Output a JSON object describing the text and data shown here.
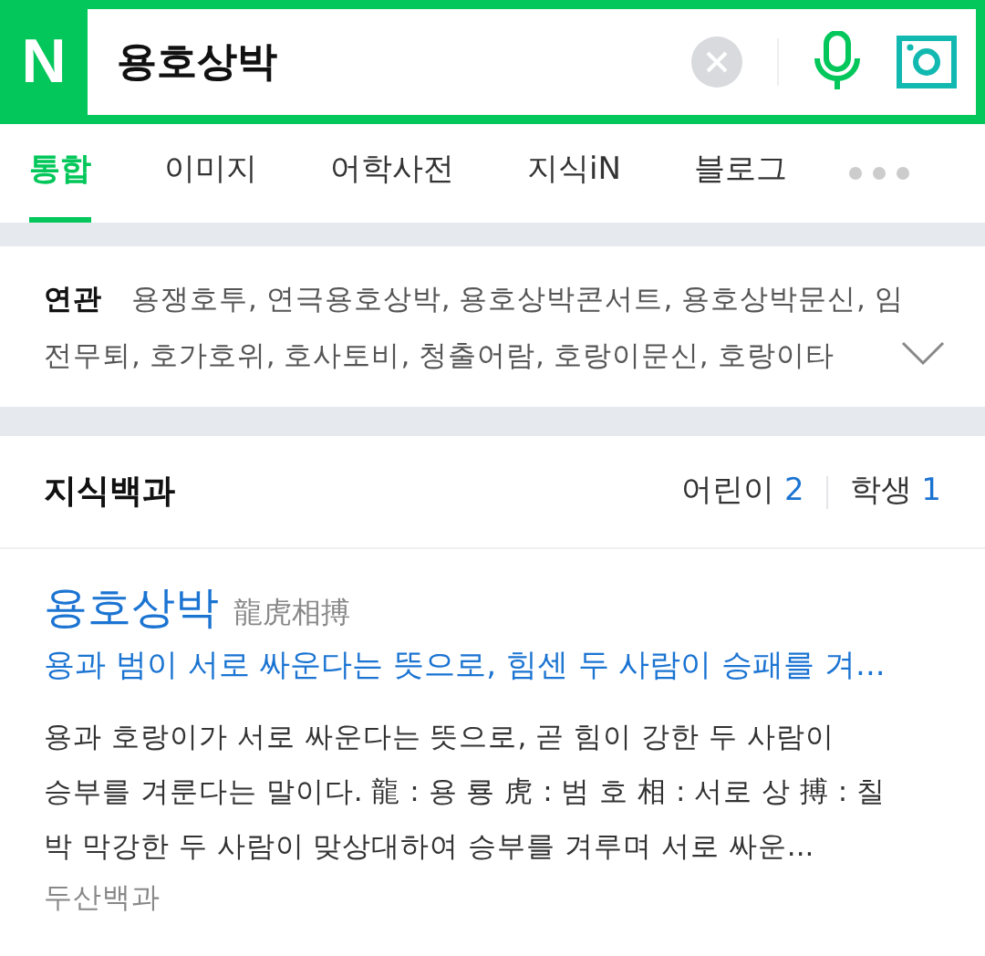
{
  "search": {
    "logo": "N",
    "query": "용호상박"
  },
  "tabs": [
    {
      "label": "통합",
      "selected": true
    },
    {
      "label": "이미지",
      "selected": false
    },
    {
      "label": "어학사전",
      "selected": false
    },
    {
      "label": "지식iN",
      "selected": false
    },
    {
      "label": "블로그",
      "selected": false
    }
  ],
  "related": {
    "label": "연관",
    "lines": [
      "용쟁호투, 연극용호상박, 용호상박콘서트, 용호상박문신, 임",
      "전무퇴, 호가호위, 호사토비, 청출어람, 호랑이문신, 호랑이타"
    ]
  },
  "section": {
    "title": "지식백과",
    "filters": [
      {
        "label": "어린이",
        "count": "2"
      },
      {
        "label": "학생",
        "count": "1"
      }
    ]
  },
  "result": {
    "title": "용호상박",
    "hanja": "龍虎相搏",
    "summary": "용과 범이 서로 싸운다는 뜻으로, 힘센 두 사람이 승패를 겨...",
    "body": "용과 호랑이가 서로 싸운다는 뜻으로, 곧 힘이 강한 두 사람이 승부를 겨룬다는 말이다. 龍 : 용 룡 虎 : 범 호 相 : 서로 상 搏 : 칠 박 막강한 두 사람이 맞상대하여 승부를 겨루며 서로 싸운...",
    "source": "두산백과"
  }
}
